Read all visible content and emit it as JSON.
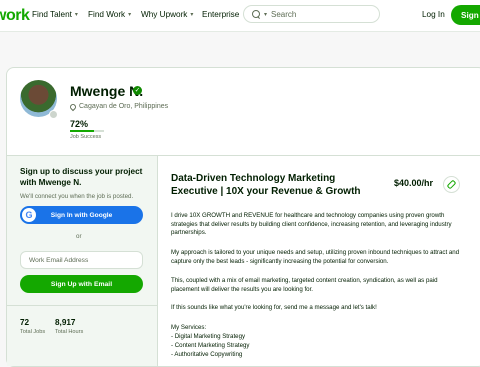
{
  "header": {
    "logo": "work",
    "nav": [
      {
        "label": "Find Talent"
      },
      {
        "label": "Find Work"
      },
      {
        "label": "Why Upwork"
      },
      {
        "label": "Enterprise"
      }
    ],
    "search_placeholder": "Search",
    "login_label": "Log In",
    "signup_label": "Sign"
  },
  "profile": {
    "name": "Mwenge N.",
    "location": "Cagayan de Oro, Philippines",
    "job_success_value": "72%",
    "job_success_fraction": 0.72,
    "job_success_label": "Job Success"
  },
  "signup_panel": {
    "title": "Sign up to discuss your project with Mwenge N.",
    "subtitle": "We'll connect you when the job is posted.",
    "google_label": "Sign In with Google",
    "google_glyph": "G",
    "or_label": "or",
    "email_placeholder": "Work Email Address",
    "email_button_label": "Sign Up with Email"
  },
  "stats": [
    {
      "value": "72",
      "label": "Total Jobs"
    },
    {
      "value": "8,917",
      "label": "Total Hours"
    }
  ],
  "listing": {
    "title": "Data-Driven Technology Marketing Executive | 10X your Revenue & Growth",
    "rate": "$40.00/hr",
    "paragraphs": [
      "I drive 10X GROWTH and REVENUE for healthcare and technology companies using proven growth strategies that deliver results by building client confidence, increasing retention, and leveraging industry partnerships.",
      "My approach is tailored to your unique needs and setup, utilizing proven inbound techniques to attract and capture only the best leads - significantly increasing the potential for conversion.",
      "This, coupled with a mix of email marketing, targeted content creation, syndication, as well as paid placement will deliver the results you are looking for.",
      "If this sounds like what you're looking for, send me a message and let's talk!"
    ],
    "services_heading": "My Services:",
    "services": [
      "- Digital Marketing Strategy",
      "- Content Marketing Strategy",
      "- Authoritative Copywriting"
    ]
  },
  "colors": {
    "brand_green": "#14a800",
    "google_blue": "#1a73e8",
    "verified_badge": "#108a00"
  },
  "icons": [
    "search-icon",
    "chevron-down-icon",
    "verified-icon",
    "location-pin-icon",
    "google-icon",
    "link-icon"
  ]
}
